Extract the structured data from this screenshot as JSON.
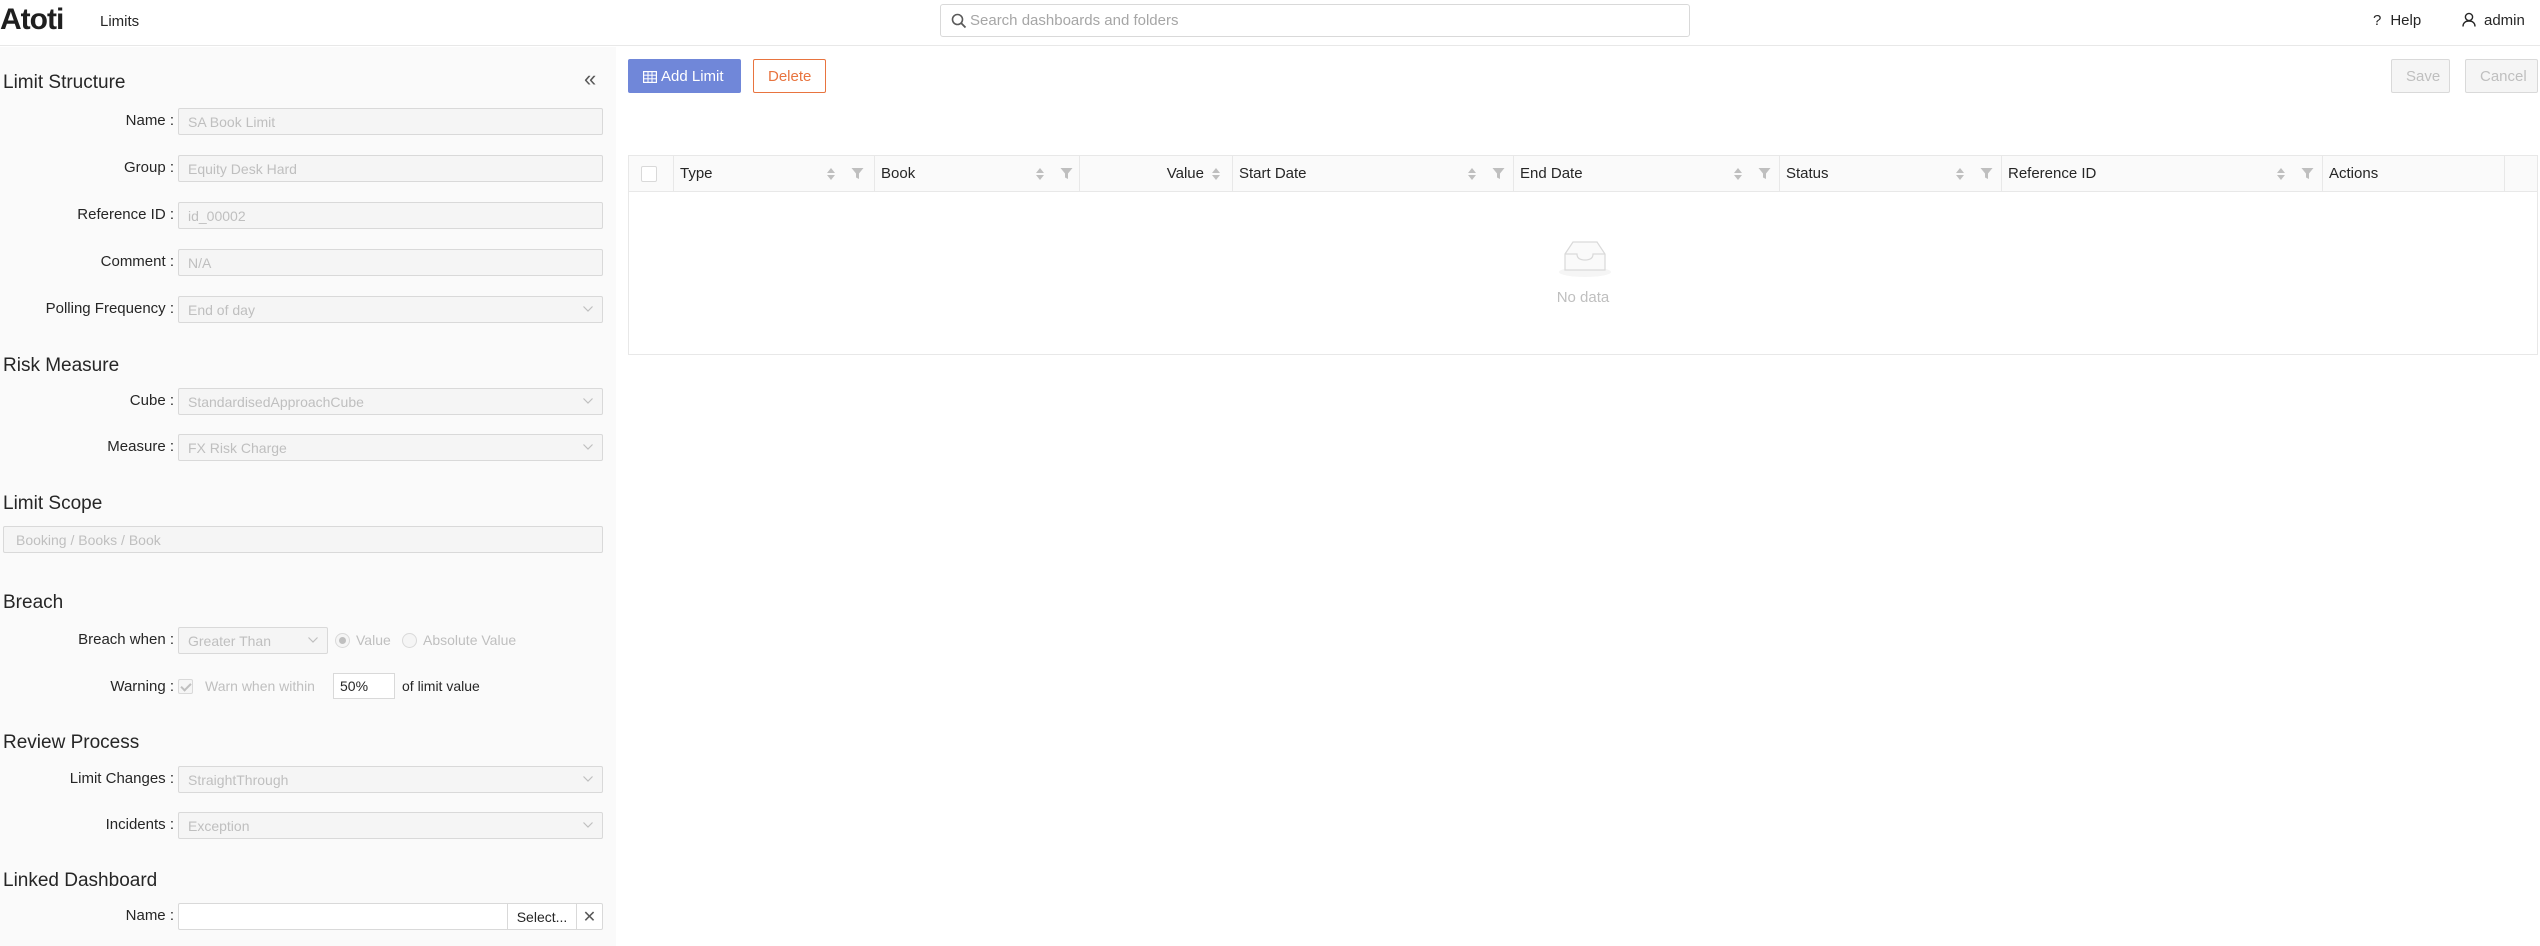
{
  "header": {
    "logo": "Atoti",
    "app_title": "Limits",
    "search_placeholder": "Search dashboards and folders",
    "help_label": "Help",
    "help_glyph": "?",
    "user_label": "admin"
  },
  "sidebar": {
    "collapse_glyph": "«",
    "limit_structure": {
      "title": "Limit Structure",
      "name_label": "Name :",
      "name_value": "SA Book Limit",
      "group_label": "Group :",
      "group_value": "Equity Desk Hard",
      "refid_label": "Reference ID :",
      "refid_value": "id_00002",
      "comment_label": "Comment :",
      "comment_value": "N/A",
      "polling_label": "Polling Frequency :",
      "polling_value": "End of day"
    },
    "risk_measure": {
      "title": "Risk Measure",
      "cube_label": "Cube :",
      "cube_value": "StandardisedApproachCube",
      "measure_label": "Measure :",
      "measure_value": "FX Risk Charge"
    },
    "limit_scope": {
      "title": "Limit Scope",
      "value": "Booking / Books / Book"
    },
    "breach": {
      "title": "Breach",
      "when_label": "Breach when :",
      "when_value": "Greater Than",
      "radio_value": "Value",
      "radio_abs": "Absolute Value",
      "warning_label": "Warning :",
      "warn_text": "Warn when within",
      "warn_pct": "50%",
      "warn_suffix": "of limit value"
    },
    "review": {
      "title": "Review Process",
      "changes_label": "Limit Changes :",
      "changes_value": "StraightThrough",
      "incidents_label": "Incidents :",
      "incidents_value": "Exception"
    },
    "linked": {
      "title": "Linked Dashboard",
      "name_label": "Name :",
      "select_label": "Select...",
      "clear_glyph": "✕"
    }
  },
  "toolbar": {
    "add_label": "Add Limit",
    "delete_label": "Delete",
    "save_label": "Save",
    "cancel_label": "Cancel"
  },
  "table": {
    "columns": {
      "type": "Type",
      "book": "Book",
      "value": "Value",
      "start_date": "Start Date",
      "end_date": "End Date",
      "status": "Status",
      "reference_id": "Reference ID",
      "actions": "Actions"
    },
    "empty_text": "No data"
  },
  "colors": {
    "primary": "#7087d9",
    "danger": "#e8743f"
  }
}
